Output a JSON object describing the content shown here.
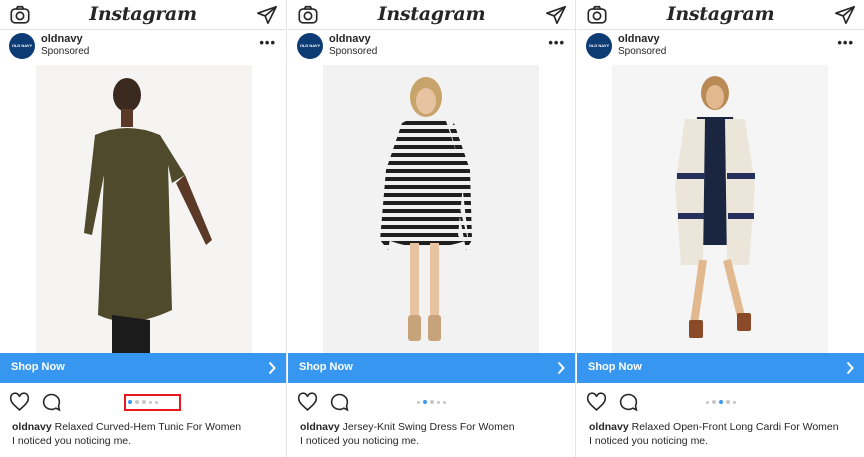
{
  "app": {
    "wordmark": "Instagram"
  },
  "posts": [
    {
      "username": "oldnavy",
      "sponsored_label": "Sponsored",
      "avatar_text": "OLD NAVY",
      "more_icon": "more-horizontal-icon",
      "cta_label": "Shop Now",
      "caption_user": "oldnavy",
      "caption_text": "Relaxed Curved-Hem Tunic For Women",
      "tagline": "I noticed you noticing me.",
      "carousel": {
        "count": 5,
        "active_index": 0,
        "highlighted": true
      }
    },
    {
      "username": "oldnavy",
      "sponsored_label": "Sponsored",
      "avatar_text": "OLD NAVY",
      "more_icon": "more-horizontal-icon",
      "cta_label": "Shop Now",
      "caption_user": "oldnavy",
      "caption_text": "Jersey-Knit Swing Dress For Women",
      "tagline": "I noticed you noticing me.",
      "carousel": {
        "count": 5,
        "active_index": 1,
        "highlighted": false
      }
    },
    {
      "username": "oldnavy",
      "sponsored_label": "Sponsored",
      "avatar_text": "OLD NAVY",
      "more_icon": "more-horizontal-icon",
      "cta_label": "Shop Now",
      "caption_user": "oldnavy",
      "caption_text": "Relaxed Open-Front Long Cardi For Women",
      "tagline": "I noticed you noticing me.",
      "carousel": {
        "count": 5,
        "active_index": 2,
        "highlighted": false
      }
    }
  ],
  "colors": {
    "cta_blue": "#3797f0",
    "dot_active": "#3797f0",
    "dot_inactive": "#c7c7c7",
    "highlight_red": "#e8191f",
    "brand_navy": "#0d3b73"
  },
  "icons": [
    "camera-icon",
    "send-icon",
    "heart-icon",
    "comment-icon",
    "chevron-right-icon"
  ]
}
